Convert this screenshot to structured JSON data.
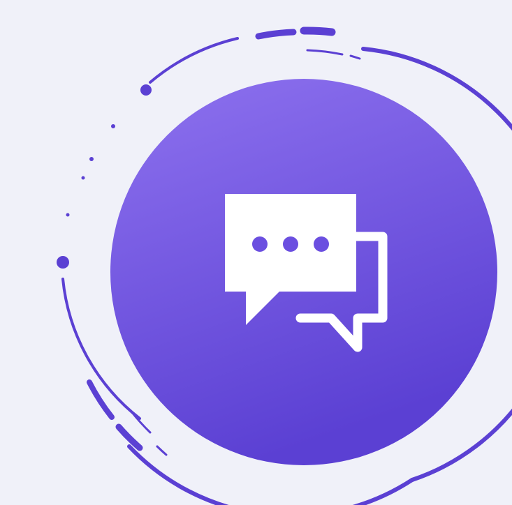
{
  "icon": {
    "name": "chat-bubbles-icon",
    "glyph_color": "#ffffff"
  },
  "colors": {
    "background": "#f0f1f9",
    "circle_gradient_top": "#8e72ef",
    "circle_gradient_bottom": "#5b40d3",
    "ring_stroke": "#5b40d3"
  }
}
